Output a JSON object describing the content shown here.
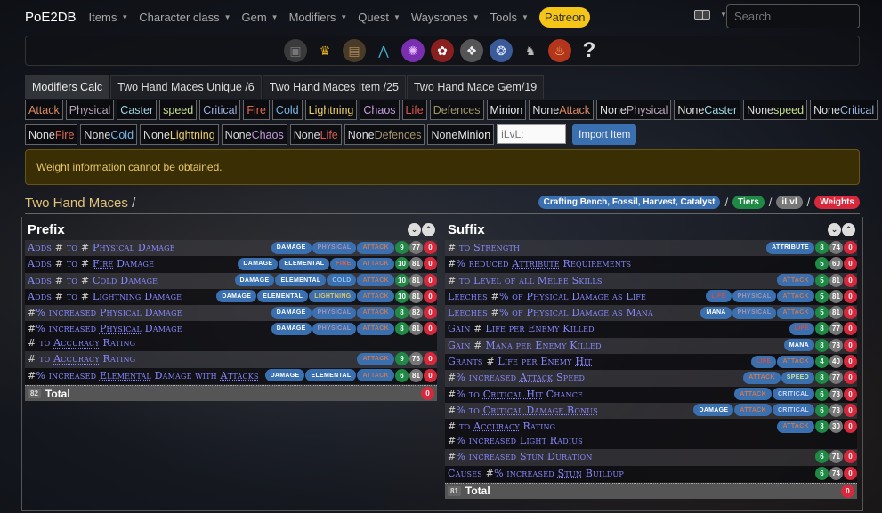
{
  "nav": {
    "brand": "PoE2DB",
    "items": [
      "Items",
      "Character class",
      "Gem",
      "Modifiers",
      "Quest",
      "Waystones",
      "Tools"
    ],
    "patreon": "Patreon",
    "search_placeholder": "Search",
    "lang_icon": "translate-icon"
  },
  "icon_bar": [
    "currency-icon",
    "crown-icon",
    "chest-icon",
    "ascendancy-icon",
    "purple-orb-icon",
    "red-orb-icon",
    "grey-orb-icon",
    "blue-orb-icon",
    "statue-icon",
    "fire-emblem-icon",
    "question-icon"
  ],
  "tabs": [
    "Modifiers Calc",
    "Two Hand Maces Unique /6",
    "Two Hand Maces Item /25",
    "Two Hand Mace Gem/19"
  ],
  "filters_row1": [
    {
      "prefix": "",
      "label": "Attack",
      "cls": "c-attack"
    },
    {
      "prefix": "",
      "label": "Physical",
      "cls": "c-physical"
    },
    {
      "prefix": "",
      "label": "Caster",
      "cls": "c-caster"
    },
    {
      "prefix": "",
      "label": "speed",
      "cls": "c-speed"
    },
    {
      "prefix": "",
      "label": "Critical",
      "cls": "c-critical"
    },
    {
      "prefix": "",
      "label": "Fire",
      "cls": "c-fire"
    },
    {
      "prefix": "",
      "label": "Cold",
      "cls": "c-cold"
    },
    {
      "prefix": "",
      "label": "Lightning",
      "cls": "c-lightning"
    },
    {
      "prefix": "",
      "label": "Chaos",
      "cls": "c-chaos"
    },
    {
      "prefix": "",
      "label": "Life",
      "cls": "c-life"
    },
    {
      "prefix": "",
      "label": "Defences",
      "cls": "c-defences"
    },
    {
      "prefix": "",
      "label": "Minion",
      "cls": "c-minion"
    },
    {
      "prefix": "None ",
      "label": "Attack",
      "cls": "c-attack"
    },
    {
      "prefix": "None ",
      "label": "Physical",
      "cls": "c-physical"
    },
    {
      "prefix": "None ",
      "label": "Caster",
      "cls": "c-caster"
    },
    {
      "prefix": "None ",
      "label": "speed",
      "cls": "c-speed"
    },
    {
      "prefix": "None ",
      "label": "Critical",
      "cls": "c-critical"
    }
  ],
  "filters_row2": [
    {
      "prefix": "None ",
      "label": "Fire",
      "cls": "c-fire"
    },
    {
      "prefix": "None ",
      "label": "Cold",
      "cls": "c-cold"
    },
    {
      "prefix": "None ",
      "label": "Lightning",
      "cls": "c-lightning"
    },
    {
      "prefix": "None ",
      "label": "Chaos",
      "cls": "c-chaos"
    },
    {
      "prefix": "None ",
      "label": "Life",
      "cls": "c-life"
    },
    {
      "prefix": "None ",
      "label": "Defences",
      "cls": "c-defences"
    },
    {
      "prefix": "None ",
      "label": "Minion",
      "cls": "c-minion"
    }
  ],
  "ilvl_placeholder": "iLvL:",
  "import_label": "Import Item",
  "alert": "Weight information cannot be obtained.",
  "breadcrumb": {
    "title": "Two Hand Maces",
    "sep": "/"
  },
  "legend": [
    {
      "label": "Crafting Bench, Fossil, Harvest, Catalyst",
      "color": "#3a6fb0"
    },
    {
      "label": "Tiers",
      "color": "#1f8a45"
    },
    {
      "label": "iLvl",
      "color": "#777"
    },
    {
      "label": "Weights",
      "color": "#d7283c"
    }
  ],
  "prefix": {
    "title": "Prefix",
    "rows": [
      {
        "html": "Adds <span class='h'>#</span> to <span class='h'>#</span> <u>Physical</u> Damage",
        "tags": [
          "damage",
          "physical",
          "attack"
        ],
        "tier": "9",
        "ilvl": "77",
        "weight": "0",
        "bg": "alt"
      },
      {
        "html": "Adds <span class='h'>#</span> to <span class='h'>#</span> <u>Fire</u> Damage",
        "tags": [
          "damage",
          "elemental",
          "fire",
          "attack"
        ],
        "tier": "10",
        "ilvl": "81",
        "weight": "0",
        "bg": "dark"
      },
      {
        "html": "Adds <span class='h'>#</span> to <span class='h'>#</span> <u>Cold</u> Damage",
        "tags": [
          "damage",
          "elemental",
          "cold",
          "attack"
        ],
        "tier": "10",
        "ilvl": "81",
        "weight": "0",
        "bg": "alt"
      },
      {
        "html": "Adds <span class='h'>#</span> to <span class='h'>#</span> <u>Lightning</u> Damage",
        "tags": [
          "damage",
          "elemental",
          "lightning",
          "attack"
        ],
        "tier": "10",
        "ilvl": "81",
        "weight": "0",
        "bg": "dark"
      },
      {
        "html": "<span class='h'>#</span>% increased <u>Physical</u> Damage",
        "tags": [
          "damage",
          "physical",
          "attack"
        ],
        "tier": "8",
        "ilvl": "82",
        "weight": "0",
        "bg": "alt"
      },
      {
        "html": "<span class='h'>#</span>% increased <u>Physical</u> Damage<br><span class='h'>#</span> to <u>Accuracy</u> Rating",
        "tags": [
          "damage",
          "physical",
          "attack"
        ],
        "tier": "8",
        "ilvl": "81",
        "weight": "0",
        "bg": "dark"
      },
      {
        "html": "<span class='h'>#</span> to <u>Accuracy</u> Rating",
        "tags": [
          "attack"
        ],
        "tier": "9",
        "ilvl": "76",
        "weight": "0",
        "bg": "alt"
      },
      {
        "html": "<span class='h'>#</span>% increased <u>Elemental</u> Damage with <u>Attacks</u>",
        "tags": [
          "damage",
          "elemental",
          "attack"
        ],
        "tier": "6",
        "ilvl": "81",
        "weight": "0",
        "bg": "dark"
      }
    ],
    "total_count": "82",
    "total_label": "Total",
    "total_weight": "0"
  },
  "suffix": {
    "title": "Suffix",
    "rows": [
      {
        "html": "<span class='h'>#</span> to <u>Strength</u>",
        "tags": [
          "attribute"
        ],
        "tier": "8",
        "ilvl": "74",
        "weight": "0",
        "bg": "alt"
      },
      {
        "html": "<span class='h'>#</span>% reduced <u>Attribute</u> Requirements",
        "tags": [],
        "tier": "5",
        "ilvl": "60",
        "weight": "0",
        "bg": "dark"
      },
      {
        "html": "<span class='h'>#</span> to Level of all <u>Melee</u> Skills",
        "tags": [
          "attack"
        ],
        "tier": "5",
        "ilvl": "81",
        "weight": "0",
        "bg": "alt"
      },
      {
        "html": "<u>Leeches</u> <span class='h'>#</span>% of <u>Physical</u> Damage as Life",
        "tags": [
          "life",
          "physical",
          "attack"
        ],
        "tier": "5",
        "ilvl": "81",
        "weight": "0",
        "bg": "dark"
      },
      {
        "html": "<u>Leeches</u> <span class='h'>#</span>% of <u>Physical</u> Damage as Mana",
        "tags": [
          "mana",
          "physical",
          "attack"
        ],
        "tier": "5",
        "ilvl": "81",
        "weight": "0",
        "bg": "alt"
      },
      {
        "html": "Gain <span class='h'>#</span> Life per Enemy Killed",
        "tags": [
          "life"
        ],
        "tier": "8",
        "ilvl": "77",
        "weight": "0",
        "bg": "dark"
      },
      {
        "html": "Gain <span class='h'>#</span> Mana per Enemy Killed",
        "tags": [
          "mana"
        ],
        "tier": "8",
        "ilvl": "78",
        "weight": "0",
        "bg": "alt"
      },
      {
        "html": "Grants <span class='h'>#</span> Life per Enemy <u>Hit</u>",
        "tags": [
          "life",
          "attack"
        ],
        "tier": "4",
        "ilvl": "40",
        "weight": "0",
        "bg": "dark"
      },
      {
        "html": "<span class='h'>#</span>% increased <u>Attack</u> Speed",
        "tags": [
          "attack",
          "speed"
        ],
        "tier": "8",
        "ilvl": "77",
        "weight": "0",
        "bg": "alt"
      },
      {
        "html": "<span class='h'>#</span>% to <u>Critical Hit</u> Chance",
        "tags": [
          "attack",
          "critical"
        ],
        "tier": "6",
        "ilvl": "73",
        "weight": "0",
        "bg": "dark"
      },
      {
        "html": "<span class='h'>#</span>% to <u>Critical Damage Bonus</u>",
        "tags": [
          "damage",
          "attack",
          "critical"
        ],
        "tier": "6",
        "ilvl": "73",
        "weight": "0",
        "bg": "alt"
      },
      {
        "html": "<span class='h'>#</span> to <u>Accuracy</u> Rating<br><span class='h'>#</span>% increased <u>Light Radius</u>",
        "tags": [
          "attack"
        ],
        "tier": "3",
        "ilvl": "30",
        "weight": "0",
        "bg": "dark"
      },
      {
        "html": "<span class='h'>#</span>% increased <u>Stun</u> Duration",
        "tags": [],
        "tier": "6",
        "ilvl": "71",
        "weight": "0",
        "bg": "alt"
      },
      {
        "html": "Causes <span class='h'>#</span>% increased <u>Stun</u> Buildup",
        "tags": [],
        "tier": "6",
        "ilvl": "74",
        "weight": "0",
        "bg": "dark"
      }
    ],
    "total_count": "81",
    "total_label": "Total",
    "total_weight": "0"
  }
}
